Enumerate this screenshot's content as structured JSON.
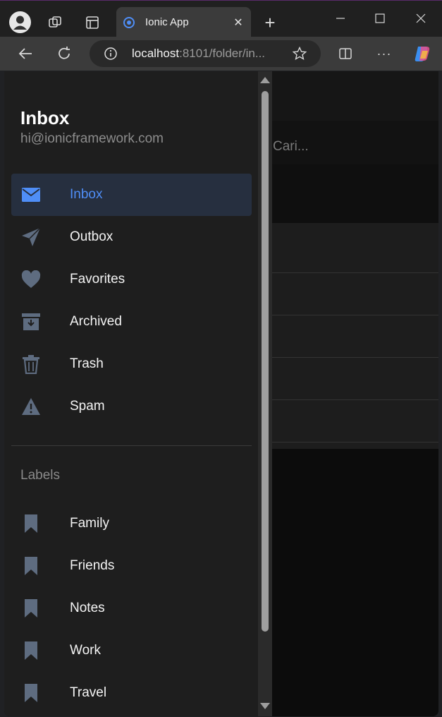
{
  "browser": {
    "tab_title": "Ionic App",
    "url_host": "localhost",
    "url_rest": ":8101/folder/in..."
  },
  "background": {
    "search_text": "Cari..."
  },
  "menu": {
    "title": "Inbox",
    "subtitle": "hi@ionicframework.com",
    "items": [
      {
        "label": "Inbox",
        "icon": "mail-icon",
        "selected": true
      },
      {
        "label": "Outbox",
        "icon": "paper-plane-icon",
        "selected": false
      },
      {
        "label": "Favorites",
        "icon": "heart-icon",
        "selected": false
      },
      {
        "label": "Archived",
        "icon": "archive-icon",
        "selected": false
      },
      {
        "label": "Trash",
        "icon": "trash-icon",
        "selected": false
      },
      {
        "label": "Spam",
        "icon": "warning-icon",
        "selected": false
      }
    ],
    "labels_header": "Labels",
    "labels": [
      {
        "label": "Family",
        "icon": "bookmark-icon"
      },
      {
        "label": "Friends",
        "icon": "bookmark-icon"
      },
      {
        "label": "Notes",
        "icon": "bookmark-icon"
      },
      {
        "label": "Work",
        "icon": "bookmark-icon"
      },
      {
        "label": "Travel",
        "icon": "bookmark-icon"
      }
    ]
  },
  "colors": {
    "accent": "#4f8ef7",
    "icon_gray": "#5e6c80",
    "selected_bg": "#262f3f"
  }
}
